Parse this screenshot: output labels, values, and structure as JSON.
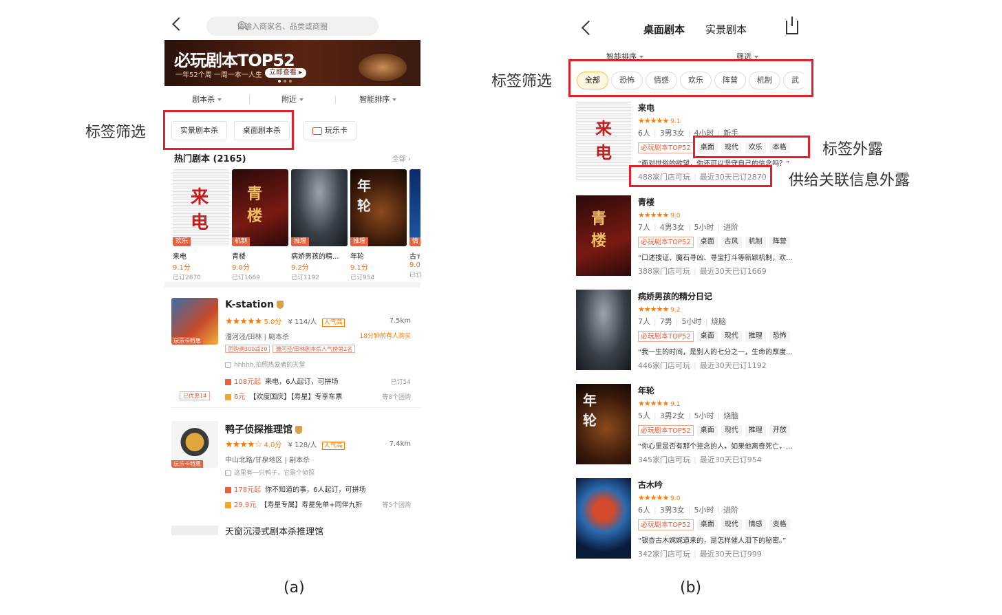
{
  "captions": {
    "a": "(a)",
    "b": "(b)"
  },
  "annotations": {
    "tag_filter_a": "标签筛选",
    "tag_filter_b": "标签筛选",
    "tag_exposure": "标签外露",
    "supply_exposure": "供给关联信息外露"
  },
  "panel_a": {
    "search_placeholder": "请输入商家名、品类或商圈",
    "banner": {
      "title": "必玩剧本TOP52",
      "subtitle": "一年52个周 一周一本一人生",
      "button": "立即查看 ▸"
    },
    "filters": [
      "剧本杀",
      "附近",
      "智能排序"
    ],
    "tags": [
      "实景剧本杀",
      "桌面剧本杀",
      "玩乐卡"
    ],
    "hot_title": "热门剧本 (2165)",
    "hot_all": "全部 ›",
    "hot": [
      {
        "tag": "欢乐",
        "name": "来电",
        "score": "9.1分",
        "orders": "已订2870"
      },
      {
        "tag": "机制",
        "name": "青楼",
        "score": "9.0分",
        "orders": "已订1669"
      },
      {
        "tag": "推理",
        "name": "病娇男孩的精...",
        "score": "9.2分",
        "orders": "已订1192"
      },
      {
        "tag": "推理",
        "name": "年轮",
        "score": "9.1分",
        "orders": "已订954"
      },
      {
        "tag": "情",
        "name": "古ד",
        "score": "9.0",
        "orders": "已订"
      }
    ],
    "shops": [
      {
        "name": "K-station",
        "stars": "★★★★★",
        "score": "5.0分",
        "price": "¥ 114/人",
        "pop": "人气高",
        "distance": "7.5km",
        "location": "漕河泾/田林 | 剧本杀",
        "recent": "18分钟前有人购买",
        "chips": [
          "团购满300减20",
          "漕河泾/田林剧本杀人气榜第2名"
        ],
        "note": "hhhhh,拍照热爱者的天堂",
        "thumb_label": "玩乐卡特惠",
        "deal1_price": "108元起",
        "deal1_text": "来电，6人起订，可拼场",
        "deal1_right": "已订54",
        "deal2_price": "6元",
        "deal2_text": "【欢度国庆】【寿星】专享车票",
        "deal2_right": "等8个团购",
        "ticket": "已优惠14"
      },
      {
        "name": "鸭子侦探推理馆",
        "stars": "★★★★☆",
        "score": "4.0分",
        "price": "¥ 128/人",
        "pop": "人气高",
        "distance": "7.4km",
        "location": "中山北路/甘泉地区 | 剧本杀",
        "note": "这里有一只鸭子，它是个侦探",
        "thumb_label": "玩乐卡特惠",
        "deal1_price": "178元起",
        "deal1_text": "你不知道的事，6人起订，可拼场",
        "deal2_price": "29.9元",
        "deal2_text": "【寿星专属】寿星免单+同伴九折",
        "deal2_right": "等5个团购"
      }
    ],
    "next_shop": "天窗沉浸式剧本杀推理馆"
  },
  "panel_b": {
    "tabs": [
      "桌面剧本",
      "实景剧本"
    ],
    "sorts": [
      "智能排序",
      "筛选"
    ],
    "chips": [
      "全部",
      "恐怖",
      "情感",
      "欢乐",
      "阵营",
      "机制",
      "武"
    ],
    "items": [
      {
        "name": "来电",
        "stars": "★★★★★",
        "score": "9.1",
        "meta": [
          "6人",
          "3男3女",
          "4小时",
          "新手"
        ],
        "top": "必玩剧本TOP52",
        "tags": [
          "桌面",
          "现代",
          "欢乐",
          "本格"
        ],
        "quote": "“面对世俗的欲望，你还可以坚守自己的信念吗？”",
        "supply": [
          "488家门店可玩",
          "最近30天已订2870"
        ]
      },
      {
        "name": "青楼",
        "stars": "★★★★★",
        "score": "9.0",
        "meta": [
          "7人",
          "4男3女",
          "5小时",
          "进阶"
        ],
        "top": "必玩剧本TOP52",
        "tags": [
          "桌面",
          "古风",
          "机制",
          "阵营"
        ],
        "quote": "“口述搜证、魔石寻凶、寻宝打斗等新颖机制，欢...",
        "supply": [
          "388家门店可玩",
          "最近30天已订1669"
        ]
      },
      {
        "name": "病娇男孩的精分日记",
        "stars": "★★★★★",
        "score": "9.2",
        "meta": [
          "7人",
          "7男",
          "5小时",
          "烧脑"
        ],
        "top": "必玩剧本TOP52",
        "tags": [
          "桌面",
          "现代",
          "推理",
          "恐怖"
        ],
        "quote": "“我一生的时间，是别人的七分之一，生命的厚度...",
        "supply": [
          "446家门店可玩",
          "最近30天已订1192"
        ]
      },
      {
        "name": "年轮",
        "stars": "★★★★★",
        "score": "9.1",
        "meta": [
          "5人",
          "3男2女",
          "5小时",
          "烧脑"
        ],
        "top": "必玩剧本TOP52",
        "tags": [
          "桌面",
          "现代",
          "推理",
          "开放"
        ],
        "quote": "“你心里是否有那个挂念的人，如果他离奇死亡，...",
        "supply": [
          "345家门店可玩",
          "最近30天已订954"
        ]
      },
      {
        "name": "古木吟",
        "stars": "★★★★★",
        "score": "9.0",
        "meta": [
          "6人",
          "3男3女",
          "5小时",
          "进阶"
        ],
        "top": "必玩剧本TOP52",
        "tags": [
          "桌面",
          "现代",
          "情感",
          "变格"
        ],
        "quote": "“银杏古木娓娓道来的，是怎样催人泪下的秘密。”",
        "supply": [
          "342家门店可玩",
          "最近30天已订999"
        ]
      }
    ]
  },
  "colors": {
    "accent": "#e8603c",
    "annotation": "#e0202a",
    "star": "#ff7a00",
    "chip_active": "#f5c04a"
  }
}
